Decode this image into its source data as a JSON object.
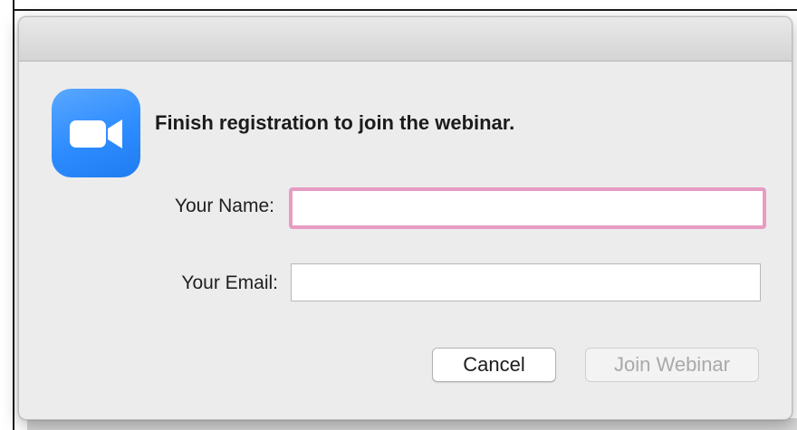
{
  "dialog": {
    "heading": "Finish registration to join the webinar.",
    "app_icon": "zoom-video-camera-icon",
    "accent_color": "#2d8cff"
  },
  "form": {
    "name_label": "Your Name:",
    "name_value": "",
    "name_focus_color": "#e79cc3",
    "email_label": "Your Email:",
    "email_value": ""
  },
  "buttons": {
    "cancel_label": "Cancel",
    "join_label": "Join Webinar",
    "join_enabled": false
  }
}
